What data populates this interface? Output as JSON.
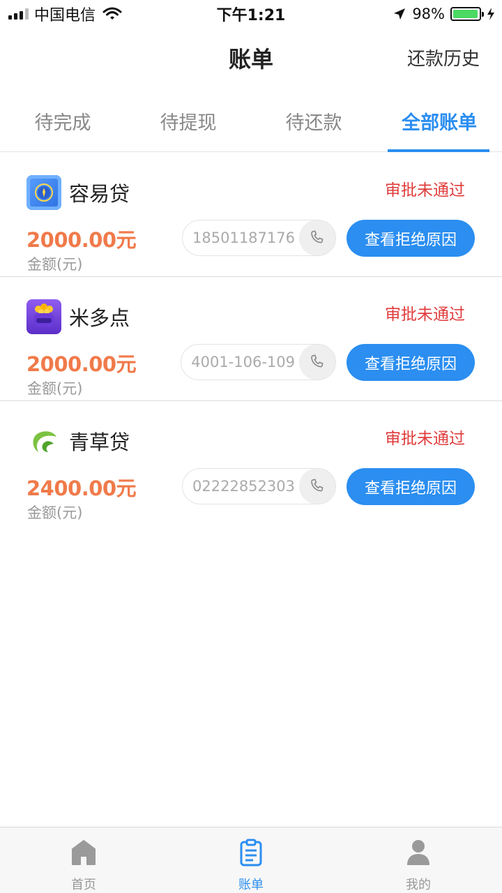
{
  "status_bar": {
    "carrier": "中国电信",
    "time": "下午1:21",
    "battery": "98%",
    "battery_level": 0.98
  },
  "navbar": {
    "title": "账单",
    "right_label": "还款历史"
  },
  "tabs": [
    {
      "label": "待完成",
      "active": false
    },
    {
      "label": "待提现",
      "active": false
    },
    {
      "label": "待还款",
      "active": false
    },
    {
      "label": "全部账单",
      "active": true
    }
  ],
  "bills": [
    {
      "name": "容易贷",
      "status": "审批未通过",
      "amount": "2000.00元",
      "amount_label": "金额(元)",
      "phone": "18501187176",
      "button": "查看拒绝原因",
      "logo": "blue-target-logo"
    },
    {
      "name": "米多点",
      "status": "审批未通过",
      "amount": "2000.00元",
      "amount_label": "金额(元)",
      "phone": "4001-106-109",
      "button": "查看拒绝原因",
      "logo": "purple-coin-bag-logo"
    },
    {
      "name": "青草贷",
      "status": "审批未通过",
      "amount": "2400.00元",
      "amount_label": "金额(元)",
      "phone": "02222852303",
      "button": "查看拒绝原因",
      "logo": "green-leaf-logo"
    }
  ],
  "tabbar": [
    {
      "label": "首页",
      "icon": "home-icon",
      "active": false
    },
    {
      "label": "账单",
      "icon": "bill-icon",
      "active": true
    },
    {
      "label": "我的",
      "icon": "profile-icon",
      "active": false
    }
  ],
  "colors": {
    "accent": "#2b8ef0",
    "amount": "#f07a4a",
    "status_rejected": "#e03c3c"
  }
}
